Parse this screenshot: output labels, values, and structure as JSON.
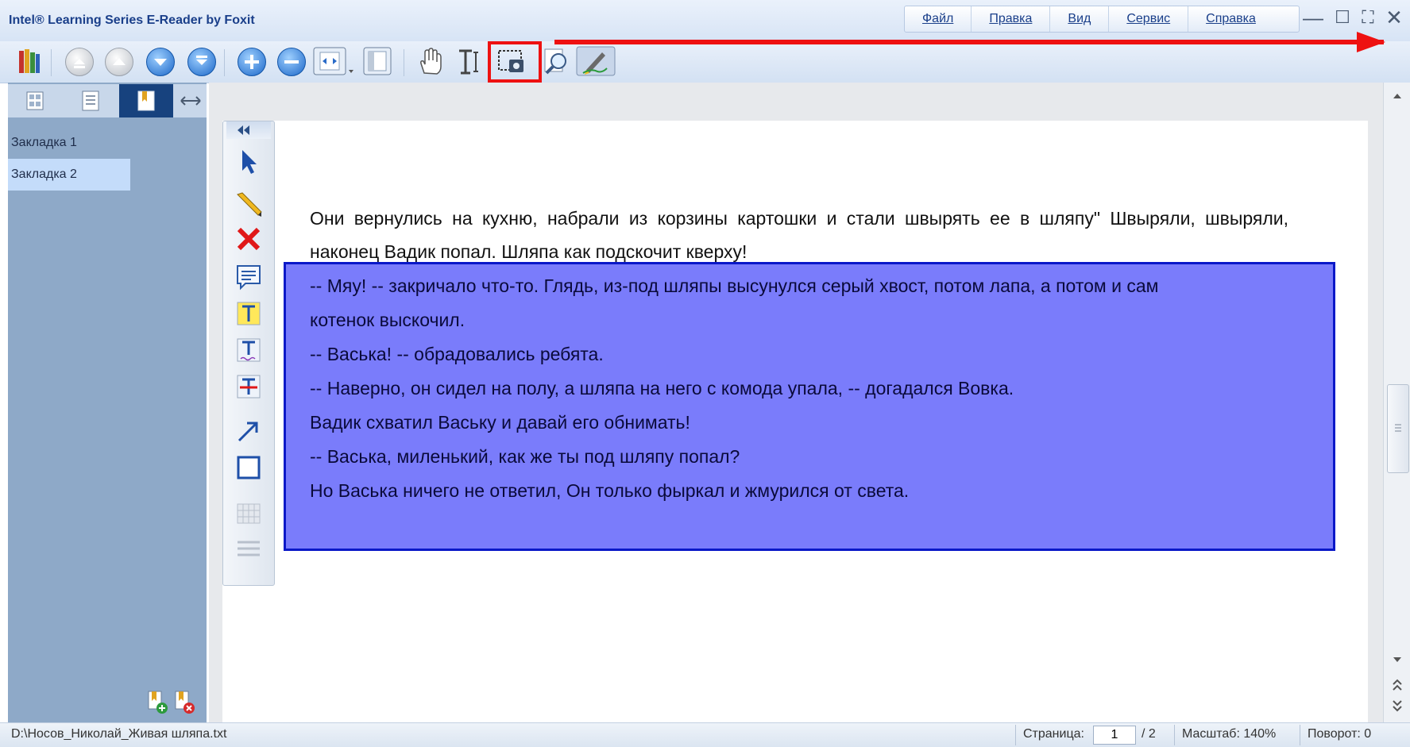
{
  "app": {
    "title": "Intel® Learning Series E-Reader by Foxit"
  },
  "menu": {
    "items": [
      "Файл",
      "Правка",
      "Вид",
      "Сервис",
      "Справка"
    ]
  },
  "window_controls": {
    "minimize": "—",
    "maximize": "☐",
    "fullscreen": "⛶",
    "close": "✕"
  },
  "sidebar": {
    "tabs": [
      "thumbnails-icon",
      "outline-icon",
      "bookmarks-icon"
    ],
    "bookmarks": [
      "Закладка 1",
      "Закладка 2"
    ],
    "selected_bookmark": 1
  },
  "document": {
    "paragraph1": "Они вернулись на кухню, набрали из корзины картошки и стали швырять ее в шляпу\" Швыряли, швыряли, наконец Вадик попал. Шляпа как подскочит кверху!",
    "highlighted_lines": [
      "-- Мяу! -- закричало что-то. Глядь, из-под шляпы высунулся серый хвост, потом лапа, а потом и сам",
      "котенок выскочил.",
      "-- Васька! -- обрадовались ребята.",
      "-- Наверно, он сидел на полу, а шляпа на него с комода упала, -- догадался Вовка.",
      "Вадик схватил Ваську и давай его обнимать!",
      "-- Васька, миленький, как же ты под шляпу попал?",
      "Но Васька ничего не ответил, Он только фыркал и жмурился от света."
    ],
    "highlight_color": "#7a7cfb",
    "highlight_border": "#0a18c8"
  },
  "status": {
    "path": "D:\\Носов_Николай_Живая шляпа.txt",
    "page_label": "Страница:",
    "page_current": "1",
    "page_total": "/ 2",
    "zoom": "Масштаб: 140%",
    "rotation": "Поворот: 0"
  },
  "annotation": {
    "color": "#ee1111"
  }
}
